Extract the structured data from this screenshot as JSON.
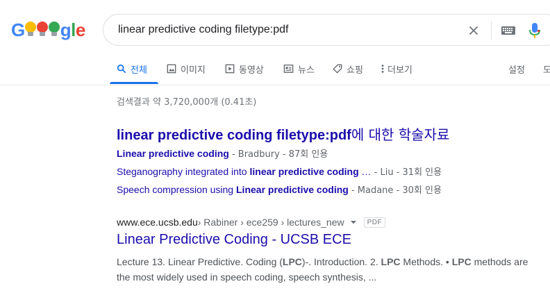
{
  "logo": {
    "letters": [
      "G",
      "o",
      "o",
      "g",
      "l",
      "e"
    ],
    "colors": [
      "#4285f4",
      "#fbbc05",
      "#ea4335",
      "#4285f4",
      "#34a853",
      "#ea4335"
    ]
  },
  "search": {
    "query": "linear predictive coding filetype:pdf"
  },
  "tabs": [
    {
      "label": "전체",
      "icon": "search-icon",
      "active": true
    },
    {
      "label": "이미지",
      "icon": "image-icon"
    },
    {
      "label": "동영상",
      "icon": "video-icon"
    },
    {
      "label": "뉴스",
      "icon": "news-icon"
    },
    {
      "label": "쇼핑",
      "icon": "tag-icon"
    },
    {
      "label": "더보기",
      "icon": "more-vert-icon"
    },
    {
      "label": "설정"
    },
    {
      "label": "도"
    }
  ],
  "stats": "검색결과 약 3,720,000개 (0.41초)",
  "scholar": {
    "title_bold": "linear predictive coding filetype:pdf",
    "title_suffix": "에 대한 학술자료",
    "items": [
      {
        "link_pre": "",
        "link_bold": "Linear predictive coding",
        "link_post": "",
        "meta": " - Bradbury - 87회 인용"
      },
      {
        "link_pre": "Steganography integrated into ",
        "link_bold": "linear predictive coding",
        "link_post": " …",
        "meta": " - Liu - 31회 인용"
      },
      {
        "link_pre": "Speech compression using ",
        "link_bold": "Linear predictive coding",
        "link_post": "",
        "meta": " - Madane - 30회 인용"
      }
    ]
  },
  "result": {
    "domain": "www.ece.ucsb.edu",
    "breadcrumb": " › Rabiner › ece259 › lectures_new",
    "badge": "PDF",
    "title": "Linear Predictive Coding - UCSB ECE",
    "snippet_parts": [
      "Lecture 13. Linear Predictive. Coding (",
      "LPC",
      ")-. Introduction. 2. ",
      "LPC",
      " Methods. • ",
      "LPC",
      " methods are the most widely used in speech coding, speech synthesis, ..."
    ]
  },
  "colors": {
    "link": "#1a0dab",
    "accent": "#1a73e8",
    "muted": "#5f6368"
  }
}
